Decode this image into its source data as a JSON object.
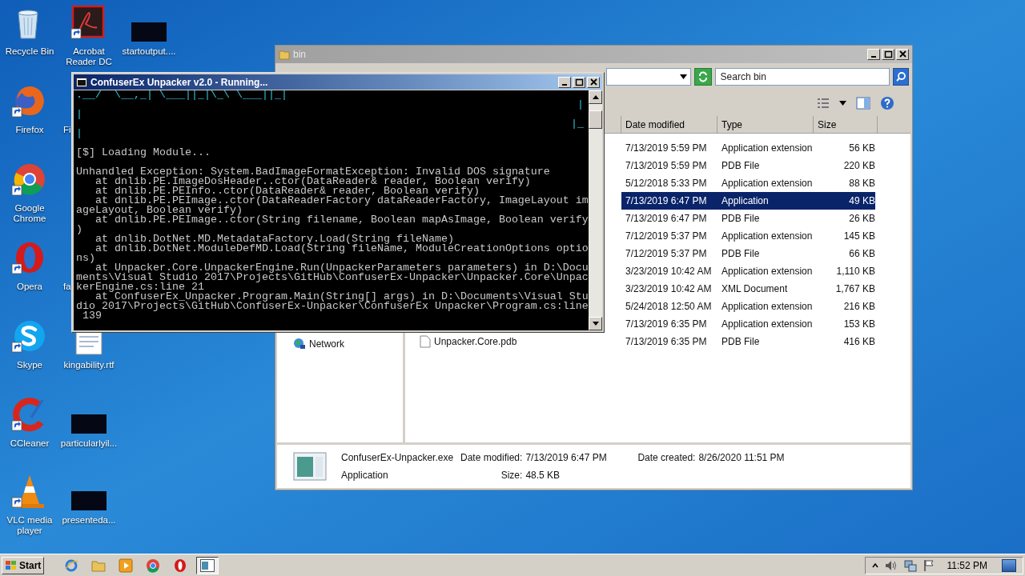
{
  "desktop_icons": [
    {
      "label": "Recycle Bin",
      "kind": "recycle",
      "shortcut": false
    },
    {
      "label": "Acrobat Reader DC",
      "kind": "acrobat",
      "shortcut": true
    },
    {
      "label": "startoutput....",
      "kind": "thumbnail",
      "shortcut": false
    },
    {
      "label": "Firefox",
      "kind": "firefox",
      "shortcut": true
    },
    {
      "label": "Fi",
      "kind": "covered"
    },
    {
      "label": "Google Chrome",
      "kind": "chrome",
      "shortcut": true
    },
    {
      "label": "Opera",
      "kind": "opera",
      "shortcut": true
    },
    {
      "label": "fa",
      "kind": "covered"
    },
    {
      "label": "Skype",
      "kind": "skype",
      "shortcut": true
    },
    {
      "label": "kingability.rtf",
      "kind": "document",
      "shortcut": false
    },
    {
      "label": "CCleaner",
      "kind": "ccleaner",
      "shortcut": true
    },
    {
      "label": "particularlyil...",
      "kind": "thumbnail",
      "shortcut": false
    },
    {
      "label": "VLC media player",
      "kind": "vlc",
      "shortcut": true
    },
    {
      "label": "presenteda...",
      "kind": "thumbnail",
      "shortcut": false
    }
  ],
  "explorer": {
    "title": "bin",
    "search": {
      "placeholder": "Search bin"
    },
    "columns": [
      "Date modified",
      "Type",
      "Size"
    ],
    "rows": [
      {
        "date": "7/13/2019 5:59 PM",
        "type": "Application extension",
        "size": "56 KB",
        "selected": false
      },
      {
        "date": "7/13/2019 5:59 PM",
        "type": "PDB File",
        "size": "220 KB",
        "selected": false
      },
      {
        "date": "5/12/2018 5:33 PM",
        "type": "Application extension",
        "size": "88 KB",
        "selected": false
      },
      {
        "date": "7/13/2019 6:47 PM",
        "type": "Application",
        "size": "49 KB",
        "selected": true
      },
      {
        "date": "7/13/2019 6:47 PM",
        "type": "PDB File",
        "size": "26 KB",
        "selected": false
      },
      {
        "date": "7/12/2019 5:37 PM",
        "type": "Application extension",
        "size": "145 KB",
        "selected": false
      },
      {
        "date": "7/12/2019 5:37 PM",
        "type": "PDB File",
        "size": "66 KB",
        "selected": false
      },
      {
        "date": "3/23/2019 10:42 AM",
        "type": "Application extension",
        "size": "1,110 KB",
        "selected": false
      },
      {
        "date": "3/23/2019 10:42 AM",
        "type": "XML Document",
        "size": "1,767 KB",
        "selected": false
      },
      {
        "date": "5/24/2018 12:50 AM",
        "type": "Application extension",
        "size": "216 KB",
        "selected": false
      },
      {
        "date": "7/13/2019 6:35 PM",
        "type": "Application extension",
        "size": "153 KB",
        "selected": false
      },
      {
        "name": "Unpacker.Core.pdb",
        "date": "7/13/2019 6:35 PM",
        "type": "PDB File",
        "size": "416 KB",
        "selected": false
      }
    ],
    "nav_items": [
      "Network"
    ],
    "details": {
      "name": "ConfuserEx-Unpacker.exe",
      "type": "Application",
      "modified_label": "Date modified:",
      "modified": "7/13/2019 6:47 PM",
      "size_label": "Size:",
      "size": "48.5 KB",
      "created_label": "Date created:",
      "created": "8/26/2020 11:51 PM"
    }
  },
  "console": {
    "title": "ConfuserEx Unpacker v2.0 - Running...",
    "lines": [
      {
        "kind": "banner",
        "left": ".__/  \\__,_| \\___||_|\\_\\ \\___||_|"
      },
      {
        "kind": "banner",
        "right": "|"
      },
      {
        "kind": "banner",
        "left": "|"
      },
      {
        "kind": "banner",
        "right": "|_"
      },
      {
        "kind": "banner",
        "left": "|"
      },
      {
        "kind": "blank"
      },
      {
        "kind": "text",
        "text": "[$] Loading Module..."
      },
      {
        "kind": "blank"
      },
      {
        "kind": "text",
        "text": "Unhandled Exception: System.BadImageFormatException: Invalid DOS signature"
      },
      {
        "kind": "text",
        "text": "   at dnlib.PE.ImageDosHeader..ctor(DataReader& reader, Boolean verify)"
      },
      {
        "kind": "text",
        "text": "   at dnlib.PE.PEInfo..ctor(DataReader& reader, Boolean verify)"
      },
      {
        "kind": "text",
        "text": "   at dnlib.PE.PEImage..ctor(DataReaderFactory dataReaderFactory, ImageLayout im"
      },
      {
        "kind": "text",
        "text": "ageLayout, Boolean verify)"
      },
      {
        "kind": "text",
        "text": "   at dnlib.PE.PEImage..ctor(String filename, Boolean mapAsImage, Boolean verify"
      },
      {
        "kind": "text",
        "text": ")"
      },
      {
        "kind": "text",
        "text": "   at dnlib.DotNet.MD.MetadataFactory.Load(String fileName)"
      },
      {
        "kind": "text",
        "text": "   at dnlib.DotNet.ModuleDefMD.Load(String fileName, ModuleCreationOptions optio"
      },
      {
        "kind": "text",
        "text": "ns)"
      },
      {
        "kind": "text",
        "text": "   at Unpacker.Core.UnpackerEngine.Run(UnpackerParameters parameters) in D:\\Docu"
      },
      {
        "kind": "text",
        "text": "ments\\Visual Studio 2017\\Projects\\GitHub\\ConfuserEx-Unpacker\\Unpacker.Core\\Unpac"
      },
      {
        "kind": "text",
        "text": "kerEngine.cs:line 21"
      },
      {
        "kind": "text",
        "text": "   at ConfuserEx_Unpacker.Program.Main(String[] args) in D:\\Documents\\Visual Stu"
      },
      {
        "kind": "text",
        "text": "dio 2017\\Projects\\GitHub\\ConfuserEx-Unpacker\\ConfuserEx Unpacker\\Program.cs:line"
      },
      {
        "kind": "text",
        "text": " 139"
      }
    ]
  },
  "taskbar": {
    "start": "Start",
    "apps": [
      {
        "kind": "ie",
        "selected": false
      },
      {
        "kind": "explorer",
        "selected": false
      },
      {
        "kind": "media",
        "selected": false
      },
      {
        "kind": "chrome",
        "selected": false
      },
      {
        "kind": "opera",
        "selected": false
      },
      {
        "kind": "console",
        "selected": true
      }
    ],
    "clock": "11:52 PM"
  }
}
